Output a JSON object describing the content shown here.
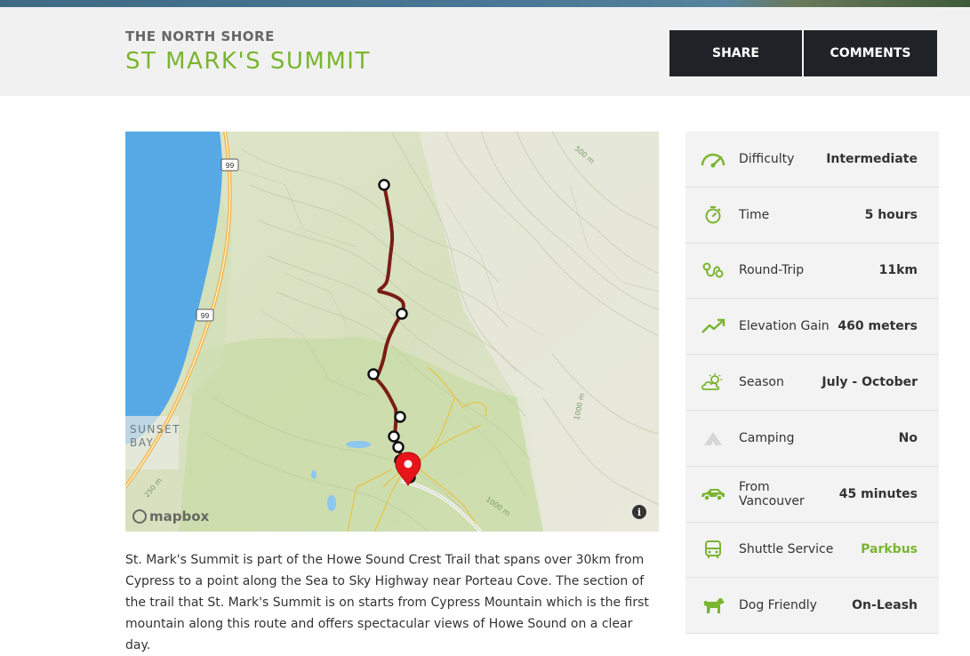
{
  "header": {
    "region": "THE NORTH SHORE",
    "title": "ST MARK'S SUMMIT",
    "share_label": "SHARE",
    "comments_label": "COMMENTS"
  },
  "map": {
    "highway_label_top": "99",
    "highway_label_mid": "99",
    "place_label_1": "SUNSET",
    "place_label_2": "BAY",
    "contour_label_500": "500 m",
    "contour_label_1000_right": "1000 m",
    "contour_label_1000_bottom": "1000 m",
    "contour_label_250": "250 m",
    "attribution": "mapbox",
    "info_symbol": "i",
    "icons": [
      "mapbox-logo-icon",
      "info-icon",
      "location-pin-icon",
      "waypoint-icon"
    ],
    "colors": {
      "water": "#57a9e6",
      "trail": "#7a1d16",
      "pin": "#e8141b",
      "land": "#e6ebd3"
    }
  },
  "description": "St. Mark's Summit is part of the Howe Sound Crest Trail that spans over 30km from Cypress to a point along the Sea to Sky Highway near Porteau Cove. The section of the trail that St. Mark's Summit is on starts from Cypress Mountain which is the first mountain along this route and offers spectacular views of Howe Sound on a clear day.",
  "stats": [
    {
      "icon": "gauge-icon",
      "label": "Difficulty",
      "value": "Intermediate"
    },
    {
      "icon": "stopwatch-icon",
      "label": "Time",
      "value": "5 hours"
    },
    {
      "icon": "loop-route-icon",
      "label": "Round-Trip",
      "value": "11km"
    },
    {
      "icon": "trend-up-icon",
      "label": "Elevation Gain",
      "value": "460 meters"
    },
    {
      "icon": "cloud-sun-icon",
      "label": "Season",
      "value": "July - October"
    },
    {
      "icon": "tent-icon",
      "label": "Camping",
      "value": "No"
    },
    {
      "icon": "car-icon",
      "label": "From Vancouver",
      "value": "45 minutes"
    },
    {
      "icon": "bus-icon",
      "label": "Shuttle Service",
      "value": "Parkbus"
    },
    {
      "icon": "dog-icon",
      "label": "Dog Friendly",
      "value": "On-Leash"
    }
  ],
  "accent_color": "#7ab530",
  "button_color": "#1f2327"
}
